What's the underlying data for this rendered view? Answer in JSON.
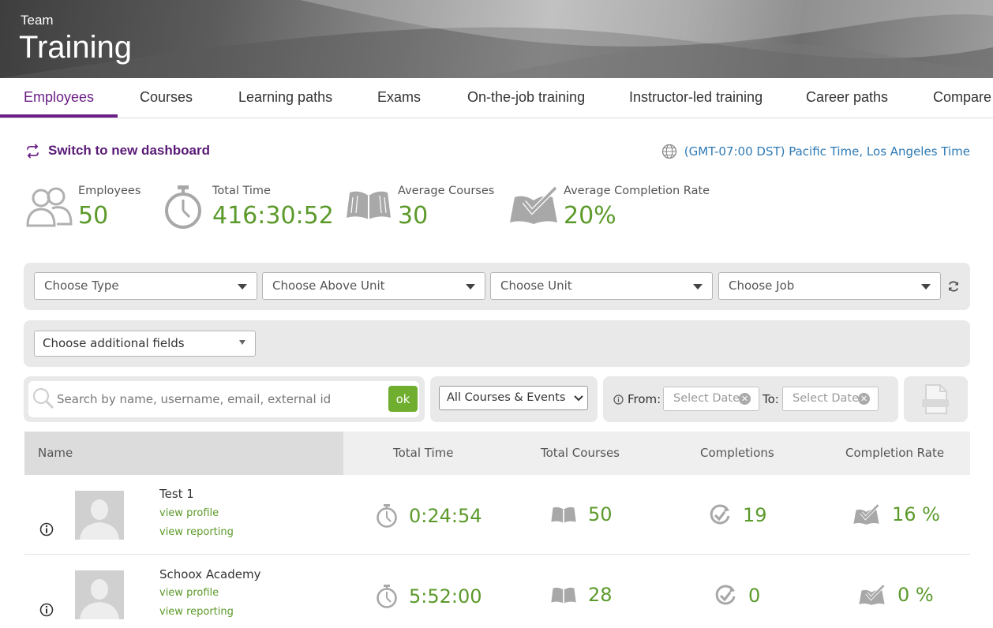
{
  "header": {
    "supertitle": "Team",
    "title": "Training"
  },
  "tabs": [
    {
      "label": "Employees",
      "active": true
    },
    {
      "label": "Courses"
    },
    {
      "label": "Learning paths"
    },
    {
      "label": "Exams"
    },
    {
      "label": "On-the-job training"
    },
    {
      "label": "Instructor-led training"
    },
    {
      "label": "Career paths"
    },
    {
      "label": "Compare"
    }
  ],
  "switch_dashboard": {
    "label": "Switch to new dashboard",
    "icon": "switch-arrows-icon"
  },
  "timezone": {
    "label": "(GMT-07:00 DST) Pacific Time, Los Angeles Time",
    "icon": "globe-icon"
  },
  "stats": [
    {
      "label": "Employees",
      "value": "50",
      "icon": "people-icon"
    },
    {
      "label": "Total Time",
      "value": "416:30:52",
      "icon": "stopwatch-icon"
    },
    {
      "label": "Average Courses",
      "value": "30",
      "icon": "book-icon"
    },
    {
      "label": "Average Completion Rate",
      "value": "20%",
      "icon": "check-book-icon"
    }
  ],
  "filters": {
    "type": "Choose Type",
    "above_unit": "Choose Above Unit",
    "unit": "Choose Unit",
    "job": "Choose Job",
    "additional_fields": "Choose additional fields"
  },
  "search": {
    "placeholder": "Search by name, username, email, external id",
    "button": "ok"
  },
  "course_filter": {
    "selected": "All Courses & Events"
  },
  "date_range": {
    "from_label": "From:",
    "to_label": "To:",
    "from_placeholder": "Select Date",
    "to_placeholder": "Select Date"
  },
  "export_icon": "excel-export-icon",
  "table": {
    "columns": [
      "Name",
      "Total Time",
      "Total Courses",
      "Completions",
      "Completion Rate"
    ],
    "rows": [
      {
        "name": "Test 1",
        "view_profile": "view profile",
        "view_reporting": "view reporting",
        "total_time": "0:24:54",
        "total_courses": "50",
        "completions": "19",
        "completion_rate": "16 %"
      },
      {
        "name": "Schoox Academy",
        "view_profile": "view profile",
        "view_reporting": "view reporting",
        "total_time": "5:52:00",
        "total_courses": "28",
        "completions": "0",
        "completion_rate": "0 %"
      }
    ]
  },
  "colors": {
    "brand_purple": "#6b1f86",
    "accent_green": "#5c9a2b",
    "link_blue": "#2e7ab5",
    "ok_green": "#6fae2e"
  }
}
